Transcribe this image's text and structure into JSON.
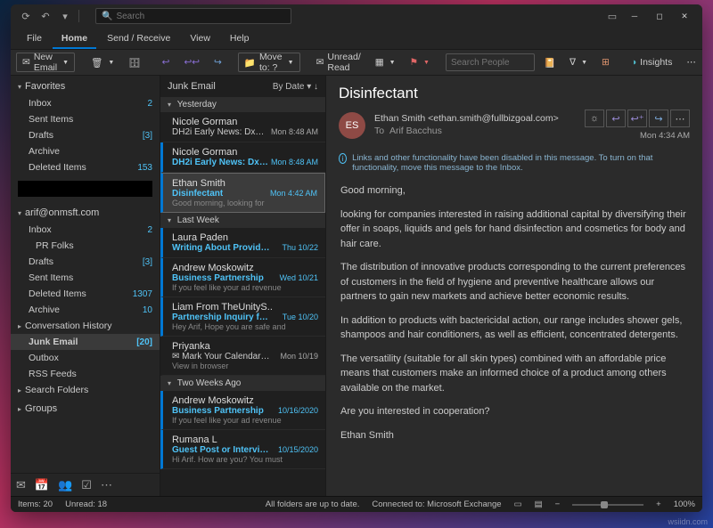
{
  "search_placeholder": "Search",
  "tabs": {
    "file": "File",
    "home": "Home",
    "sendreceive": "Send / Receive",
    "view": "View",
    "help": "Help"
  },
  "ribbon": {
    "new_email": "New Email",
    "move_to": "Move to: ?",
    "unread_read": "Unread/ Read",
    "search_people": "Search People",
    "insights": "Insights"
  },
  "nav": {
    "favorites": "Favorites",
    "favorites_items": [
      {
        "label": "Inbox",
        "count": "2"
      },
      {
        "label": "Sent Items",
        "count": ""
      },
      {
        "label": "Drafts",
        "count": "[3]"
      },
      {
        "label": "Archive",
        "count": ""
      },
      {
        "label": "Deleted Items",
        "count": "153"
      }
    ],
    "account": "arif@onmsft.com",
    "tree": [
      {
        "label": "Inbox",
        "count": "2",
        "cls": ""
      },
      {
        "label": "PR Folks",
        "count": "",
        "cls": "sub"
      },
      {
        "label": "Drafts",
        "count": "[3]",
        "cls": ""
      },
      {
        "label": "Sent Items",
        "count": "",
        "cls": ""
      },
      {
        "label": "Deleted Items",
        "count": "1307",
        "cls": ""
      },
      {
        "label": "Archive",
        "count": "10",
        "cls": ""
      },
      {
        "label": "Conversation History",
        "count": "",
        "cls": "",
        "chev": true
      },
      {
        "label": "Junk Email",
        "count": "[20]",
        "cls": "sel"
      },
      {
        "label": "Outbox",
        "count": "",
        "cls": ""
      },
      {
        "label": "RSS Feeds",
        "count": "",
        "cls": ""
      },
      {
        "label": "Search Folders",
        "count": "",
        "cls": "",
        "chev": true
      }
    ],
    "groups": "Groups"
  },
  "list": {
    "folder": "Junk Email",
    "sort": "By Date",
    "groups": [
      {
        "title": "Yesterday",
        "items": [
          {
            "from": "Nicole Gorman",
            "subj": "DH2i Early News: DxOdyssey f..",
            "date": "Mon 8:48 AM",
            "prev": "",
            "unread": false,
            "plain": true
          },
          {
            "from": "Nicole Gorman",
            "subj": "DH2i Early News: DxOdysse..",
            "date": "Mon 8:48 AM",
            "prev": "",
            "unread": true
          },
          {
            "from": "Ethan Smith",
            "subj": "Disinfectant",
            "date": "Mon 4:42 AM",
            "prev": "Good morning,  looking for",
            "unread": true,
            "sel": true
          }
        ]
      },
      {
        "title": "Last Week",
        "items": [
          {
            "from": "Laura Paden",
            "subj": "Writing About Providing To..",
            "date": "Thu 10/22",
            "prev": "",
            "unread": true
          },
          {
            "from": "Andrew Moskowitz",
            "subj": "Business Partnership",
            "date": "Wed 10/21",
            "prev": "If you feel like your ad revenue",
            "unread": true
          },
          {
            "from": "Liam From TheUnityS..",
            "subj": "Partnership Inquiry for Arif.",
            "date": "Tue 10/20",
            "prev": "Hey Arif,  Hope you are safe and",
            "unread": true
          },
          {
            "from": "Priyanka",
            "subj": "✉ Mark Your Calendars to M..",
            "date": "Mon 10/19",
            "prev": "View in browser",
            "unread": false,
            "plain": true
          }
        ]
      },
      {
        "title": "Two Weeks Ago",
        "items": [
          {
            "from": "Andrew Moskowitz",
            "subj": "Business Partnership",
            "date": "10/16/2020",
            "prev": "If you feel like your ad revenue",
            "unread": true
          },
          {
            "from": "Rumana L",
            "subj": "Guest Post or Interview opp..",
            "date": "10/15/2020",
            "prev": "Hi Arif.  How are you?  You must",
            "unread": true
          }
        ]
      }
    ]
  },
  "reader": {
    "subject": "Disinfectant",
    "avatar": "ES",
    "from": "Ethan Smith <ethan.smith@fullbizgoal.com>",
    "to_label": "To",
    "to": "Arif Bacchus",
    "date": "Mon 4:34 AM",
    "info": "Links and other functionality have been disabled in this message. To turn on that functionality, move this message to the Inbox.",
    "body": [
      "Good morning,",
      "looking for companies interested in raising additional capital by diversifying their offer in soaps, liquids and gels for hand disinfection and cosmetics for body and hair care.",
      "The distribution of innovative products corresponding to the current preferences of customers in the field of hygiene and preventive healthcare allows our partners to gain new markets and achieve better economic results.",
      "In addition to products with bactericidal action, our range includes shower gels, shampoos and hair conditioners, as well as efficient, concentrated detergents.",
      "The versatility (suitable for all skin types) combined with an affordable price means that customers make an informed choice of a product among others available on the market.",
      "Are you interested in cooperation?",
      "Ethan Smith"
    ]
  },
  "status": {
    "items": "Items: 20",
    "unread": "Unread: 18",
    "sync": "All folders are up to date.",
    "conn": "Connected to: Microsoft Exchange",
    "zoom": "100%"
  },
  "watermark": "wsiidn.com"
}
